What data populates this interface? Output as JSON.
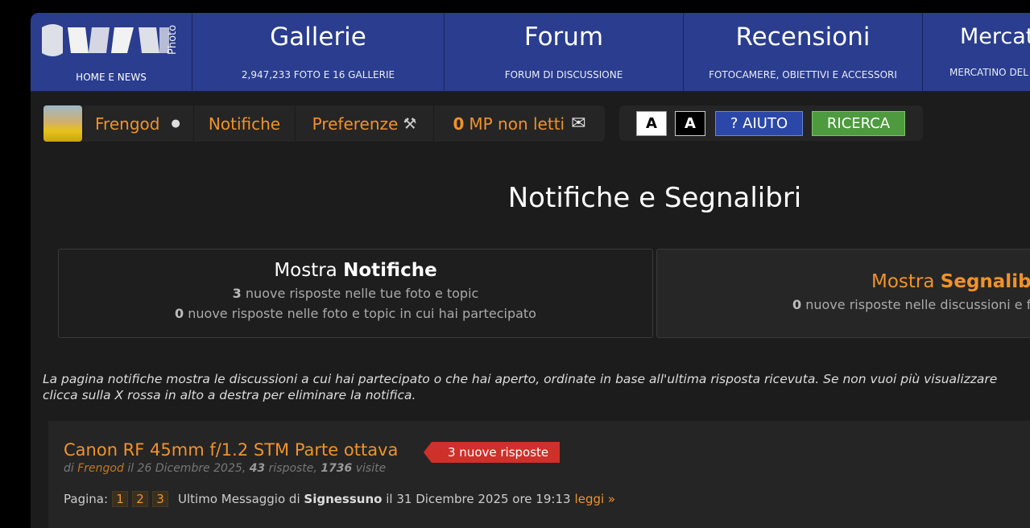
{
  "nav": {
    "logo_side_text": "Photo",
    "home_label": "HOME E NEWS",
    "items": [
      {
        "title": "Gallerie",
        "sub": "2,947,233 FOTO E 16 GALLERIE"
      },
      {
        "title": "Forum",
        "sub": "FORUM DI DISCUSSIONE"
      },
      {
        "title": "Recensioni",
        "sub": "FOTOCAMERE, OBIETTIVI E ACCESSORI"
      },
      {
        "title": "Mercat",
        "sub": "MERCATINO DEL"
      }
    ]
  },
  "userbar": {
    "username": "Frengod",
    "notifications": "Notifiche",
    "preferences": "Preferenze",
    "mp_count": "0",
    "mp_label": "MP non letti"
  },
  "tools": {
    "light": "A",
    "dark": "A",
    "help": "? AIUTO",
    "search": "RICERCA"
  },
  "page_title": "Notifiche e Segnalibri",
  "panel_notif": {
    "title_prefix": "Mostra",
    "title_bold": "Notifiche",
    "line1_count": "3",
    "line1_text": "nuove risposte nelle tue foto e topic",
    "line2_count": "0",
    "line2_text": "nuove risposte nelle foto e topic in cui hai partecipato"
  },
  "panel_book": {
    "title_prefix": "Mostra",
    "title_bold": "Segnalibr",
    "line_count": "0",
    "line_text": "nuove risposte nelle discussioni e f"
  },
  "info": {
    "line1": "La pagina notifiche mostra le discussioni a cui hai partecipato o che hai aperto, ordinate in base all'ultima risposta ricevuta. Se non vuoi più visualizzare",
    "line2": "clicca sulla X rossa in alto a destra per eliminare la notifica."
  },
  "topic": {
    "title": "Canon RF 45mm f/1.2 STM Parte ottava",
    "badge": "3 nuove risposte",
    "meta_by": "di",
    "author": "Frengod",
    "meta_date": "il 26 Dicembre 2025,",
    "replies": "43",
    "replies_label": "risposte,",
    "visits": "1736",
    "visits_label": "visite",
    "pages_label": "Pagina:",
    "pages": [
      "1",
      "2",
      "3"
    ],
    "last_prefix": "Ultimo Messaggio di",
    "last_author": "Signessuno",
    "last_date": "il 31 Dicembre 2025 ore 19:13",
    "read_link": "leggi »"
  }
}
